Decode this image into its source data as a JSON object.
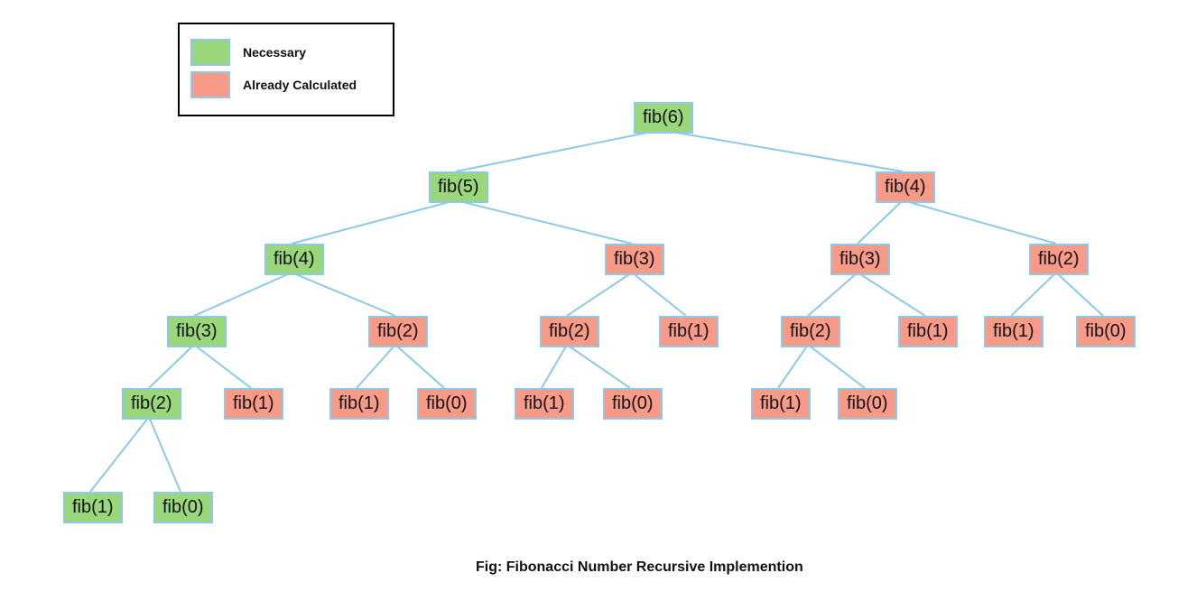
{
  "legend": {
    "necessary_label": "Necessary",
    "already_label": "Already Calculated"
  },
  "caption": "Fig: Fibonacci Number Recursive Implemention",
  "colors": {
    "necessary": "#9ad67a",
    "already": "#f89a88",
    "border": "#8ec9e9"
  },
  "nodes": {
    "n_root": "fib(6)",
    "n_5": "fib(5)",
    "n_4r": "fib(4)",
    "n_4l": "fib(4)",
    "n_3m": "fib(3)",
    "n_3r": "fib(3)",
    "n_2rr": "fib(2)",
    "n_3l": "fib(3)",
    "n_2lm": "fib(2)",
    "n_2mm": "fib(2)",
    "n_1mr": "fib(1)",
    "n_2rm": "fib(2)",
    "n_1rm": "fib(1)",
    "n_1rr": "fib(1)",
    "n_0rr": "fib(0)",
    "n_2ll": "fib(2)",
    "n_1ll2": "fib(1)",
    "n_1lm": "fib(1)",
    "n_0lm": "fib(0)",
    "n_1mm": "fib(1)",
    "n_0mm": "fib(0)",
    "n_1rm2": "fib(1)",
    "n_0rm": "fib(0)",
    "n_1bot": "fib(1)",
    "n_0bot": "fib(0)"
  }
}
